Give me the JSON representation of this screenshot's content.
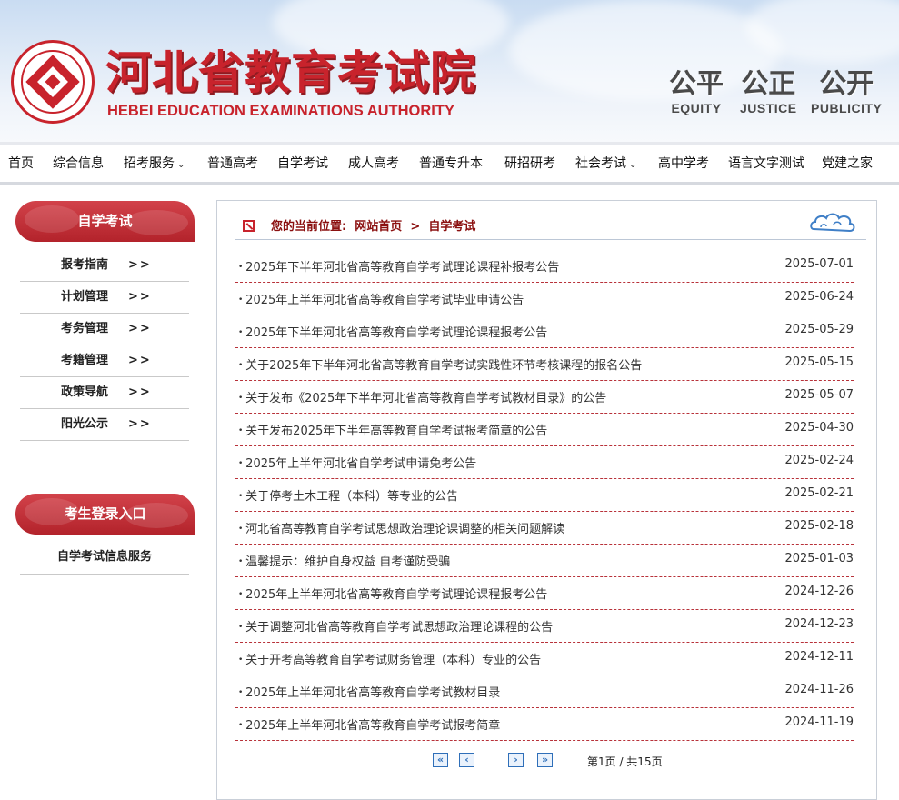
{
  "header": {
    "site_name_cn": "河北省教育考试院",
    "site_name_en": "HEBEI EDUCATION EXAMINATIONS AUTHORITY",
    "logo_ring_text": "河北省教育考试院 HEBEI EDUCATION EXAMINATIONS AUTHORITY",
    "motto": [
      {
        "zh": "公平",
        "en": "EQUITY"
      },
      {
        "zh": "公正",
        "en": "JUSTICE"
      },
      {
        "zh": "公开",
        "en": "PUBLICITY"
      }
    ]
  },
  "nav": {
    "items": [
      {
        "label": "首页"
      },
      {
        "label": "综合信息"
      },
      {
        "label": "招考服务",
        "dropdown": true
      },
      {
        "label": "普通高考"
      },
      {
        "label": "自学考试"
      },
      {
        "label": "成人高考"
      },
      {
        "label": "普通专升本"
      },
      {
        "label": "研招研考"
      },
      {
        "label": "社会考试",
        "dropdown": true
      },
      {
        "label": "高中学考"
      },
      {
        "label": "语言文字测试"
      },
      {
        "label": "党建之家"
      }
    ],
    "chevron": "⌄"
  },
  "sidebar": {
    "section_title": "自学考试",
    "arrow": ">>",
    "items": [
      {
        "label": "报考指南"
      },
      {
        "label": "计划管理"
      },
      {
        "label": "考务管理"
      },
      {
        "label": "考籍管理"
      },
      {
        "label": "政策导航"
      },
      {
        "label": "阳光公示"
      }
    ],
    "login_title": "考生登录入口",
    "login_link": "自学考试信息服务"
  },
  "breadcrumb": {
    "prefix": "您的当前位置:",
    "home": "网站首页",
    "separator": ">",
    "current": "自学考试"
  },
  "articles": [
    {
      "title": "2025年下半年河北省高等教育自学考试理论课程补报考公告",
      "date": "2025-07-01"
    },
    {
      "title": "2025年上半年河北省高等教育自学考试毕业申请公告",
      "date": "2025-06-24"
    },
    {
      "title": "2025年下半年河北省高等教育自学考试理论课程报考公告",
      "date": "2025-05-29"
    },
    {
      "title": "关于2025年下半年河北省高等教育自学考试实践性环节考核课程的报名公告",
      "date": "2025-05-15"
    },
    {
      "title": "关于发布《2025年下半年河北省高等教育自学考试教材目录》的公告",
      "date": "2025-05-07"
    },
    {
      "title": "关于发布2025年下半年高等教育自学考试报考简章的公告",
      "date": "2025-04-30"
    },
    {
      "title": "2025年上半年河北省自学考试申请免考公告",
      "date": "2025-02-24"
    },
    {
      "title": "关于停考土木工程（本科）等专业的公告",
      "date": "2025-02-21"
    },
    {
      "title": "河北省高等教育自学考试思想政治理论课调整的相关问题解读",
      "date": "2025-02-18"
    },
    {
      "title": "温馨提示：维护自身权益 自考谨防受骗",
      "date": "2025-01-03"
    },
    {
      "title": "2025年上半年河北省高等教育自学考试理论课程报考公告",
      "date": "2024-12-26"
    },
    {
      "title": "关于调整河北省高等教育自学考试思想政治理论课程的公告",
      "date": "2024-12-23"
    },
    {
      "title": "关于开考高等教育自学考试财务管理（本科）专业的公告",
      "date": "2024-12-11"
    },
    {
      "title": "2025年上半年河北省高等教育自学考试教材目录",
      "date": "2024-11-26"
    },
    {
      "title": "2025年上半年河北省高等教育自学考试报考简章",
      "date": "2024-11-19"
    }
  ],
  "pagination": {
    "first": "«",
    "prev": "‹",
    "next": "›",
    "last": "»",
    "info": "第1页 / 共15页"
  },
  "colors": {
    "brand_red": "#c8232c",
    "breadcrumb_text": "#8b1010",
    "row_divider": "#b8323a",
    "pager_blue": "#2f6fb9"
  }
}
